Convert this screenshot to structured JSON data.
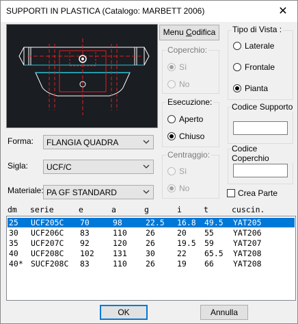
{
  "window": {
    "title": "SUPPORTI IN PLASTICA  (Catalogo: MARBETT 2006)",
    "close_glyph": "✕"
  },
  "menu_codifica": {
    "label_pre": "Menu ",
    "label_u": "C",
    "label_post": "odifica"
  },
  "coperchio": {
    "title": "Coperchio:",
    "options": [
      {
        "label": "Sì",
        "selected": true
      },
      {
        "label": "No",
        "selected": false
      }
    ]
  },
  "esecuzione": {
    "title": "Esecuzione:",
    "options": [
      {
        "label": "Aperto",
        "selected": false
      },
      {
        "label": "Chiuso",
        "selected": true
      }
    ]
  },
  "centraggio": {
    "title": "Centraggio:",
    "options": [
      {
        "label": "Sì",
        "selected": false
      },
      {
        "label": "No",
        "selected": true
      }
    ]
  },
  "tipo_vista": {
    "title": "Tipo di Vista :",
    "options": [
      {
        "label": "Laterale",
        "selected": false
      },
      {
        "label": "Frontale",
        "selected": false
      },
      {
        "label": "Pianta",
        "selected": true
      }
    ]
  },
  "codice_supporto": {
    "label": "Codice Supporto",
    "value": ""
  },
  "codice_coperchio": {
    "label": "Codice Coperchio",
    "value": ""
  },
  "crea_parte": {
    "label": "Crea Parte",
    "checked": false
  },
  "forma": {
    "label": "Forma:",
    "value": "FLANGIA QUADRA"
  },
  "sigla": {
    "label": "Sigla:",
    "value": "UCF/C"
  },
  "materiale": {
    "label": "Materiale:",
    "value": "PA GF STANDARD"
  },
  "table": {
    "headers": [
      "dm",
      "serie",
      "e",
      "a",
      "g",
      "i",
      "t",
      "cuscin."
    ],
    "rows": [
      [
        "25",
        "UCF205C",
        "70",
        "98",
        "22.5",
        "16.8",
        "49.5",
        "YAT205"
      ],
      [
        "30",
        "UCF206C",
        "83",
        "110",
        "26",
        "20",
        "55",
        "YAT206"
      ],
      [
        "35",
        "UCF207C",
        "92",
        "120",
        "26",
        "19.5",
        "59",
        "YAT207"
      ],
      [
        "40",
        "UCF208C",
        "102",
        "131",
        "30",
        "22",
        "65.5",
        "YAT208"
      ],
      [
        "40*",
        "SUCF208C",
        "83",
        "110",
        "26",
        "19",
        "66",
        "YAT208"
      ]
    ],
    "selected_row": 0
  },
  "buttons": {
    "ok": "OK",
    "annulla": "Annulla"
  },
  "colors": {
    "selection": "#0078d7",
    "drawing_white": "#ffffff",
    "drawing_red": "#e02020",
    "drawing_cyan": "#29c5d6"
  }
}
